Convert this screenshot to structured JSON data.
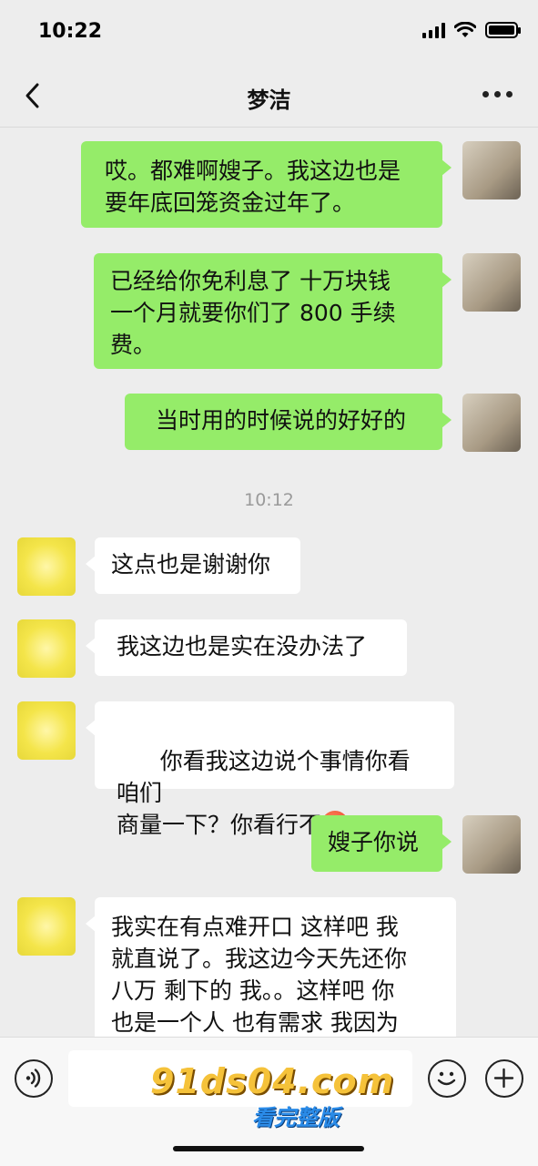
{
  "status_bar": {
    "time": "10:22"
  },
  "nav": {
    "title": "梦洁"
  },
  "messages": [
    {
      "side": "right",
      "text": "哎。都难啊嫂子。我这边也是\n要年底回笼资金过年了。"
    },
    {
      "side": "right",
      "text": "已经给你免利息了 十万块钱\n一个月就要你们了 800 手续\n费。"
    },
    {
      "side": "right",
      "text": "当时用的时候说的好好的"
    },
    {
      "side": "left",
      "text": "这点也是谢谢你"
    },
    {
      "side": "left",
      "text": "我这边也是实在没办法了"
    },
    {
      "side": "left",
      "text": "你看我这边说个事情你看咱们\n商量一下？你看行不"
    },
    {
      "side": "right",
      "text": "嫂子你说"
    },
    {
      "side": "left",
      "text": "我实在有点难开口 这样吧 我\n就直说了。我这边今天先还你\n八万 剩下的 我。。这样吧 你\n也是一个人 也有需求 我因为\n家里孩子的问题 可不能让你起"
    }
  ],
  "timestamp": "10:12",
  "watermark": {
    "line1": "91ds04.com",
    "line2": "看完整版"
  },
  "colors": {
    "bubble_self": "#95ec69",
    "bubble_other": "#ffffff",
    "background": "#ededed"
  },
  "icons": [
    "back-icon",
    "more-icon",
    "voice-icon",
    "emoji-face-icon",
    "plus-icon"
  ]
}
